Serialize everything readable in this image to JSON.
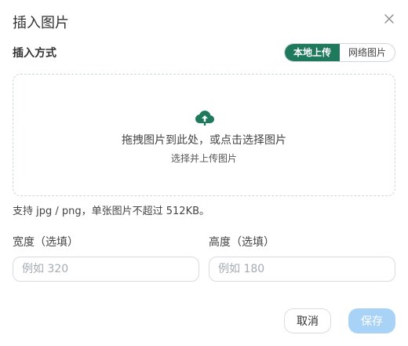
{
  "dialog": {
    "title": "插入图片",
    "close_icon": "close-icon"
  },
  "insert_mode": {
    "label": "插入方式",
    "options": [
      "本地上传",
      "网络图片"
    ],
    "selected": "本地上传"
  },
  "dropzone": {
    "icon": "cloud-upload-icon",
    "main_text": "拖拽图片到此处，或点击选择图片",
    "sub_text": "选择并上传图片"
  },
  "hint": "支持 jpg / png，单张图片不超过 512KB。",
  "width_field": {
    "label": "宽度（选填）",
    "placeholder": "例如 320",
    "value": ""
  },
  "height_field": {
    "label": "高度（选填）",
    "placeholder": "例如 180",
    "value": ""
  },
  "buttons": {
    "cancel": "取消",
    "save": "保存"
  },
  "colors": {
    "accent": "#1f7a5b",
    "save_disabled": "#a9d3f6",
    "border": "#d6dde2"
  }
}
